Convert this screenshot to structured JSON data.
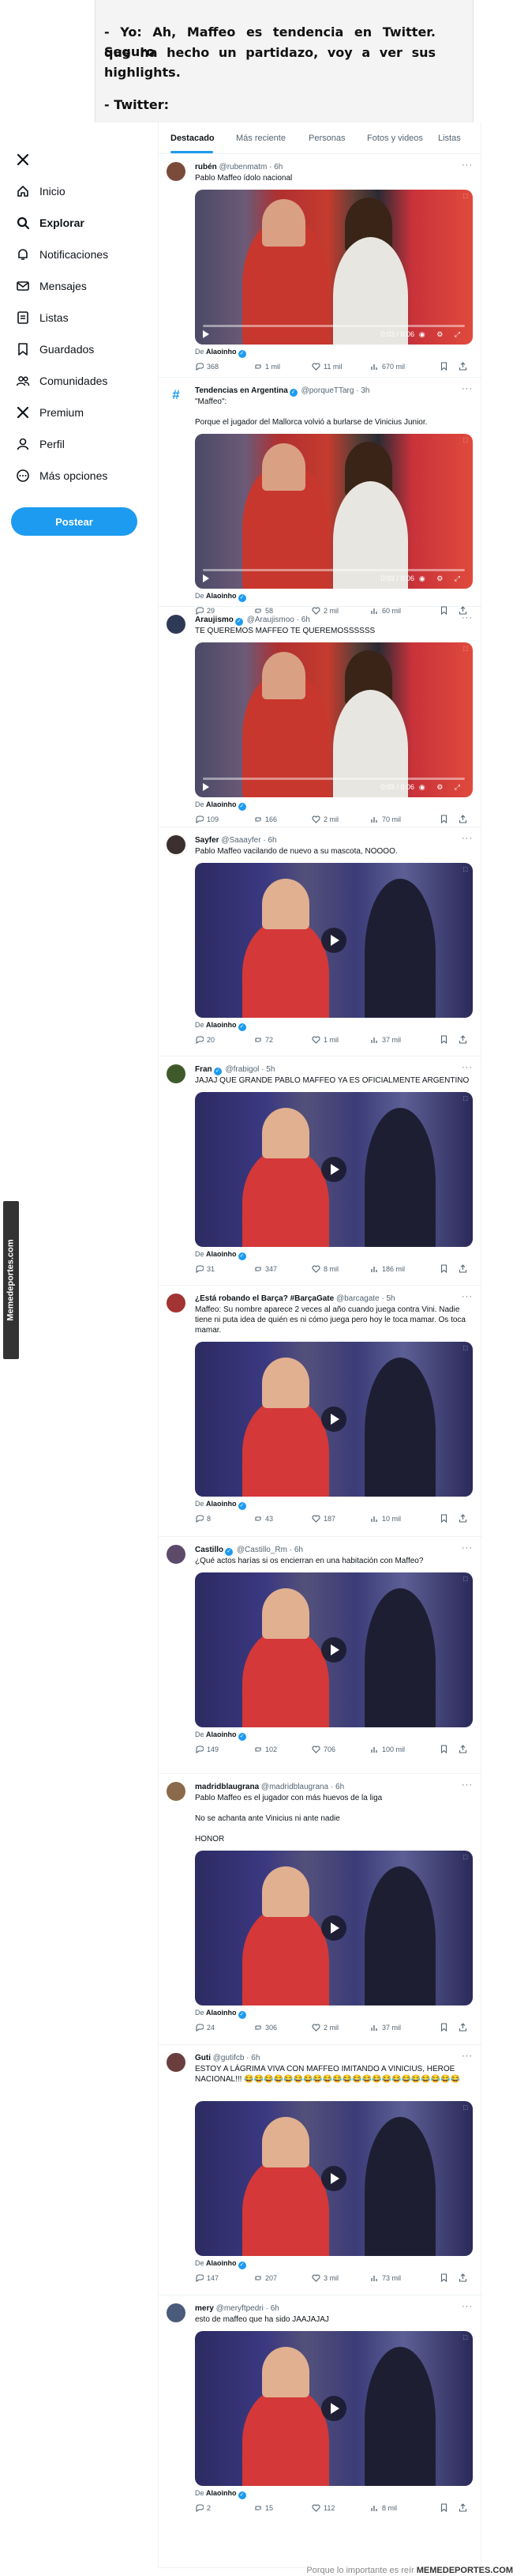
{
  "caption": {
    "line1": "- Yo: Ah, Maffeo es tendencia en Twitter. Seguro",
    "line2": "que ha hecho un partidazo, voy a ver sus highlights.",
    "line3": "- Twitter:"
  },
  "sidebar": {
    "items": [
      {
        "label": "",
        "icon": "x-logo-icon"
      },
      {
        "label": "Inicio",
        "icon": "home-icon"
      },
      {
        "label": "Explorar",
        "icon": "search-icon"
      },
      {
        "label": "Notificaciones",
        "icon": "bell-icon"
      },
      {
        "label": "Mensajes",
        "icon": "mail-icon"
      },
      {
        "label": "Listas",
        "icon": "list-icon"
      },
      {
        "label": "Guardados",
        "icon": "bookmark-icon"
      },
      {
        "label": "Comunidades",
        "icon": "people-icon"
      },
      {
        "label": "Premium",
        "icon": "x-logo-icon"
      },
      {
        "label": "Perfil",
        "icon": "person-icon"
      },
      {
        "label": "Más opciones",
        "icon": "more-circle-icon"
      }
    ],
    "post_button": "Postear"
  },
  "tabs": [
    "Destacado",
    "Más reciente",
    "Personas",
    "Fotos y videos",
    "Listas"
  ],
  "side_watermark": "Memedeportes.com",
  "bottom_credit": {
    "prefix": "Porque lo importante es reír",
    "brand": "MEMEDEPORTES.COM"
  },
  "colors": {
    "accent": "#1d9bf0",
    "text": "#0f1419",
    "muted": "#536471"
  },
  "tweets": [
    {
      "name": "rubén",
      "handle": "@rubenmatm",
      "time": "6h",
      "verified": false,
      "text": "Pablo Maffeo ídolo nacional",
      "media": "scene1",
      "video_time": "0:03 / 0:06",
      "from": "Alaoinho",
      "replies": "368",
      "reposts": "1 mil",
      "likes": "11 mil",
      "views": "670 mil"
    },
    {
      "name": "Tendencias en Argentina",
      "handle": "@porqueTTarg",
      "time": "3h",
      "verified": true,
      "text": "\"Maffeo\":\n\nPorque el jugador del Mallorca volvió a burlarse de Vinicius Junior.",
      "media": "scene1",
      "video_time": "0:03 / 0:06",
      "from": "Alaoinho",
      "replies": "29",
      "reposts": "58",
      "likes": "2 mil",
      "views": "60 mil"
    },
    {
      "name": "Araujismo",
      "handle": "@Araujismoo",
      "time": "6h",
      "verified": true,
      "text": "TE QUEREMOS MAFFEO TE QUEREMOSSSSSS",
      "media": "scene1",
      "video_time": "0:03 / 0:06",
      "from": "Alaoinho",
      "replies": "109",
      "reposts": "166",
      "likes": "2 mil",
      "views": "70 mil"
    },
    {
      "name": "Sayfer",
      "handle": "@Saaayfer",
      "time": "6h",
      "verified": false,
      "text": "Pablo Maffeo vacilando de nuevo a su mascota, NOOOO.",
      "media": "scene2",
      "video_time": "",
      "from": "Alaoinho",
      "replies": "20",
      "reposts": "72",
      "likes": "1 mil",
      "views": "37 mil"
    },
    {
      "name": "Fran",
      "handle": "@frabigol",
      "time": "5h",
      "verified": true,
      "text": "JAJAJ QUE GRANDE PABLO MAFFEO YA ES OFICIALMENTE ARGENTINO",
      "media": "scene2",
      "video_time": "",
      "from": "Alaoinho",
      "replies": "31",
      "reposts": "347",
      "likes": "8 mil",
      "views": "186 mil"
    },
    {
      "name": "¿Está robando el Barça? #BarçaGate",
      "handle": "@barcagate",
      "time": "5h",
      "verified": false,
      "text": "Maffeo: Su nombre aparece 2 veces al año cuando juega contra Vini. Nadie tiene ni puta idea de quién es ni cómo juega pero hoy le toca mamar. Os toca mamar.",
      "media": "scene2",
      "video_time": "",
      "from": "Alaoinho",
      "replies": "8",
      "reposts": "43",
      "likes": "187",
      "views": "10 mil"
    },
    {
      "name": "Castillo",
      "handle": "@Castillo_Rm",
      "time": "6h",
      "verified": true,
      "text": "¿Qué actos harías si os encierran en una habitación con Maffeo?",
      "media": "scene2",
      "video_time": "",
      "from": "Alaoinho",
      "replies": "149",
      "reposts": "102",
      "likes": "706",
      "views": "100 mil"
    },
    {
      "name": "madridblaugrana",
      "handle": "@madridblaugrana",
      "time": "6h",
      "verified": false,
      "text": "Pablo Maffeo es el jugador con más huevos de la liga\n\nNo se achanta ante Vinicius ni ante nadie\n\nHONOR",
      "media": "scene2",
      "video_time": "",
      "from": "Alaoinho",
      "replies": "24",
      "reposts": "306",
      "likes": "2 mil",
      "views": "37 mil"
    },
    {
      "name": "Guti",
      "handle": "@gutifcb",
      "time": "6h",
      "verified": false,
      "text": "ESTOY A LÁGRIMA VIVA CON MAFFEO IMITANDO A VINICIUS, HEROE NACIONAL!!! 😂😂😂😂😂😂😂😂😂😂😂😂😂😂😂😂😂😂😂😂😂😂",
      "media": "scene2",
      "video_time": "",
      "from": "Alaoinho",
      "replies": "147",
      "reposts": "207",
      "likes": "3 mil",
      "views": "73 mil"
    },
    {
      "name": "mery",
      "handle": "@meryftpedri",
      "time": "6h",
      "verified": false,
      "text": "esto de maffeo que ha sido JAAJAJAJ",
      "media": "scene2",
      "video_time": "",
      "from": "Alaoinho",
      "replies": "2",
      "reposts": "15",
      "likes": "112",
      "views": "8 mil"
    }
  ]
}
